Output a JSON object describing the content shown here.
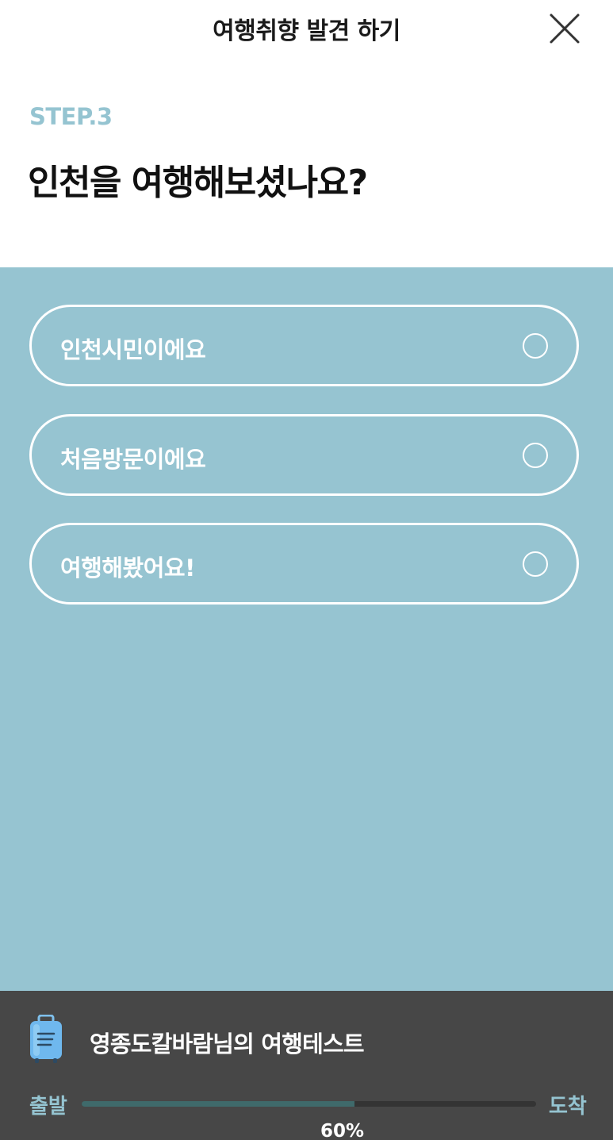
{
  "header": {
    "title": "여행취향 발견 하기",
    "close_icon": "close-icon"
  },
  "question": {
    "step": "STEP.3",
    "title": "인천을 여행해보셨나요?"
  },
  "options": [
    {
      "label": "인천시민이에요",
      "selected": false
    },
    {
      "label": "처음방문이에요",
      "selected": false
    },
    {
      "label": "여행해봤어요!",
      "selected": false
    }
  ],
  "footer": {
    "icon": "suitcase-icon",
    "title": "영종도칼바람님의 여행테스트",
    "start_label": "출발",
    "end_label": "도착",
    "progress_percent": 60,
    "progress_text": "60%"
  },
  "colors": {
    "accent": "#96c4d1",
    "footer_bg": "#474747",
    "progress_fill": "#3f6a6b"
  }
}
